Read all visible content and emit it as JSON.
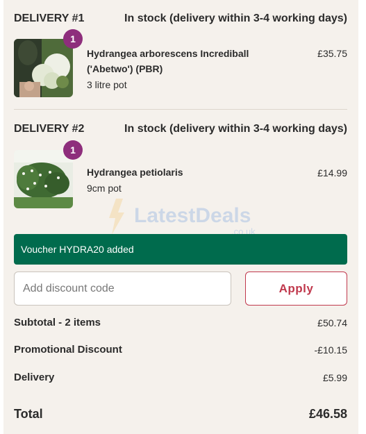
{
  "deliveries": [
    {
      "heading": "DELIVERY #1",
      "stock": "In stock (delivery within 3-4 working days)",
      "item": {
        "name": "Hydrangea arborescens Incrediball ('Abetwo') (PBR)",
        "size": "3 litre pot",
        "price": "£35.75",
        "quantity": "1",
        "image_icon": "white-hydrangea-photo"
      }
    },
    {
      "heading": "DELIVERY #2",
      "stock": "In stock (delivery within 3-4 working days)",
      "item": {
        "name": "Hydrangea petiolaris",
        "size": "9cm pot",
        "price": "£14.99",
        "quantity": "1",
        "image_icon": "climbing-hydrangea-photo"
      }
    }
  ],
  "watermark": {
    "brand": "LatestDeals",
    "domain": ".co.uk"
  },
  "voucher": {
    "message": "Voucher HYDRA20 added"
  },
  "discount": {
    "placeholder": "Add discount code",
    "value": "",
    "apply_label": "Apply"
  },
  "summary": {
    "subtotal_label": "Subtotal - 2 items",
    "subtotal_value": "£50.74",
    "promo_label": "Promotional Discount",
    "promo_value": "-£10.15",
    "delivery_label": "Delivery",
    "delivery_value": "£5.99",
    "total_label": "Total",
    "total_value": "£46.58"
  },
  "colors": {
    "background": "#f5f1ec",
    "badge": "#8e2e7c",
    "voucher_bg": "#006b4d",
    "apply_accent": "#c0384c"
  }
}
